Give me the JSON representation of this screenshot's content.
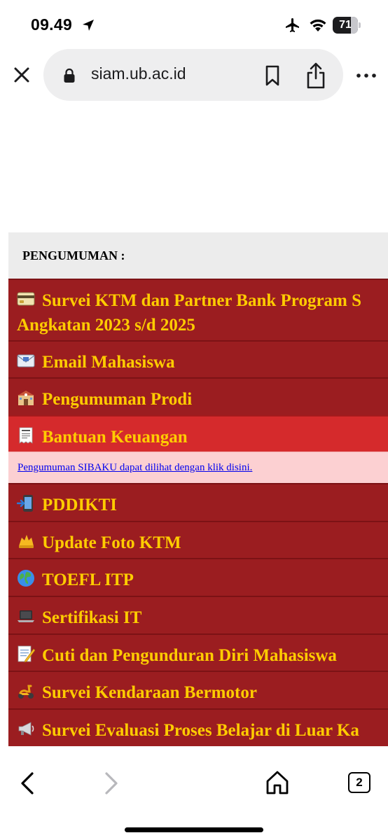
{
  "status_bar": {
    "time": "09.49",
    "battery_level": "71",
    "battery_fraction": 0.71
  },
  "browser": {
    "url": "siam.ub.ac.id"
  },
  "announcements": {
    "header": "PENGUMUMAN :",
    "items": [
      {
        "icon": "credit-card-icon",
        "label": "Survei KTM dan Partner Bank Program S",
        "label_line2": "Angkatan 2023 s/d 2025"
      },
      {
        "icon": "email-icon",
        "label": "Email Mahasiswa"
      },
      {
        "icon": "school-building-icon",
        "label": "Pengumuman Prodi"
      },
      {
        "icon": "receipt-icon",
        "label": "Bantuan Keuangan"
      },
      {
        "icon": "mobile-arrow-icon",
        "label": "PDDIKTI"
      },
      {
        "icon": "camera-flash-icon",
        "label": "Update Foto KTM"
      },
      {
        "icon": "globe-icon",
        "label": "TOEFL ITP"
      },
      {
        "icon": "laptop-icon",
        "label": "Sertifikasi IT"
      },
      {
        "icon": "memo-icon",
        "label": "Cuti dan Pengunduran Diri Mahasiswa"
      },
      {
        "icon": "scooter-icon",
        "label": "Survei Kendaraan Bermotor"
      },
      {
        "icon": "megaphone-icon",
        "label": "Survei Evaluasi Proses Belajar di Luar Ka"
      }
    ],
    "sub_notice": "Pengumuman SIBAKU dapat dilihat dengan klik disini."
  },
  "toolbar": {
    "tab_count": "2"
  }
}
